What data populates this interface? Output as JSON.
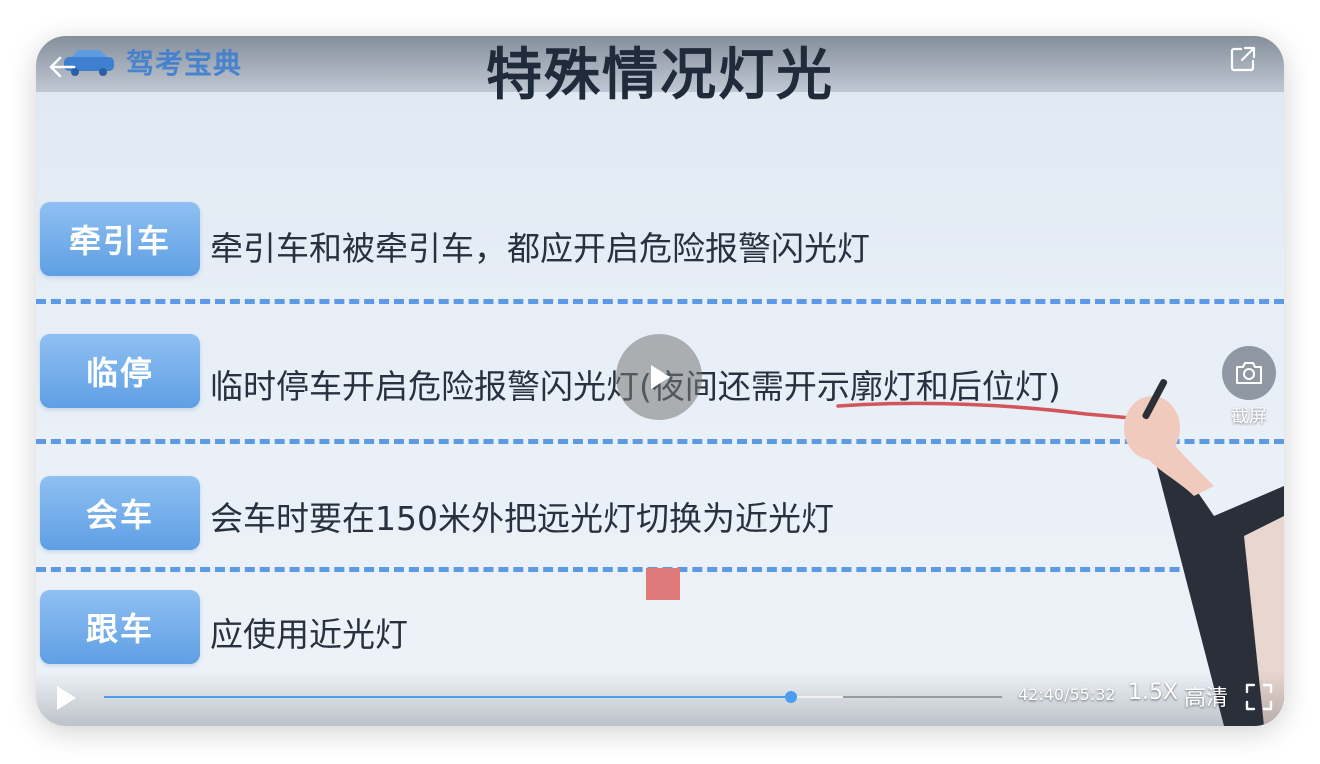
{
  "slide": {
    "logo_text": "驾考宝典",
    "title": "特殊情况灯光",
    "rows": [
      {
        "label": "牵引车",
        "text": "牵引车和被牵引车，都应开启危险报警闪光灯"
      },
      {
        "label": "临停",
        "text": "临时停车开启危险报警闪光灯(夜间还需开示廓灯和后位灯)"
      },
      {
        "label": "会车",
        "text": "会车时要在150米外把远光灯切换为近光灯"
      },
      {
        "label": "跟车",
        "text": "应使用近光灯"
      }
    ]
  },
  "overlay": {
    "screenshot_label": "截屏"
  },
  "controls": {
    "time": "42:40/55:32",
    "speed": "1.5X",
    "quality": "高清",
    "progress_fraction": 0.765,
    "buffered_fraction": 0.823
  },
  "colors": {
    "accent": "#4a9df0",
    "label_bg": "#6ba8ea",
    "dash": "#5d9ae6"
  },
  "icons": {
    "back": "back-arrow-icon",
    "share": "share-icon",
    "center_play": "play-icon",
    "screenshot": "camera-icon",
    "play": "play-icon",
    "fullscreen": "fullscreen-icon"
  }
}
